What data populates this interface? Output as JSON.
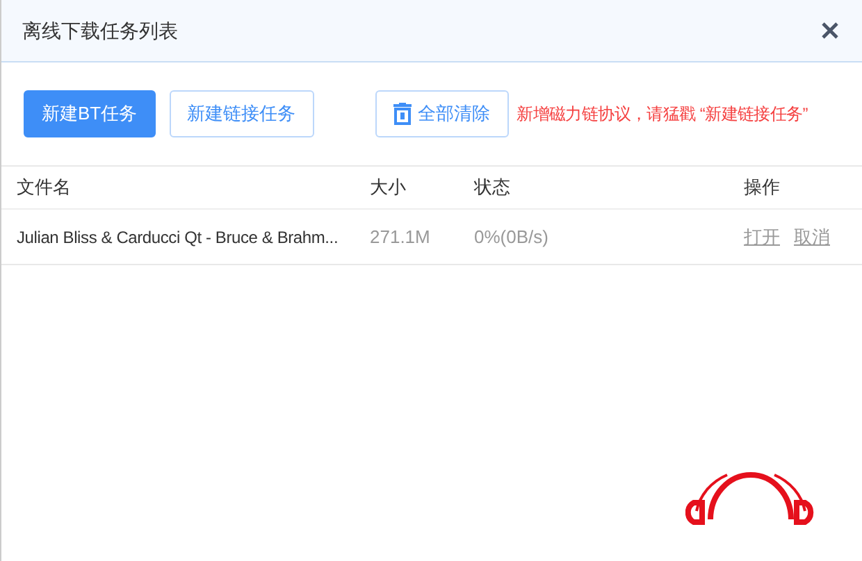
{
  "window": {
    "title": "离线下载任务列表"
  },
  "toolbar": {
    "buttons": [
      {
        "label": "新建BT任务",
        "kind": "primary"
      },
      {
        "label": "新建链接任务",
        "kind": "outline"
      },
      {
        "label": "全部清除",
        "kind": "icon"
      }
    ],
    "notice": "新增磁力链协议，请猛戳 “新建链接任务”"
  },
  "table": {
    "columns": [
      "文件名",
      "大小",
      "状态",
      "操作"
    ],
    "rows": [
      {
        "name": "Julian Bliss & Carducci Qt - Bruce & Brahm...",
        "size": "271.1M",
        "status": "0%(0B/s)",
        "actions": [
          "打开",
          "取消"
        ]
      }
    ]
  }
}
